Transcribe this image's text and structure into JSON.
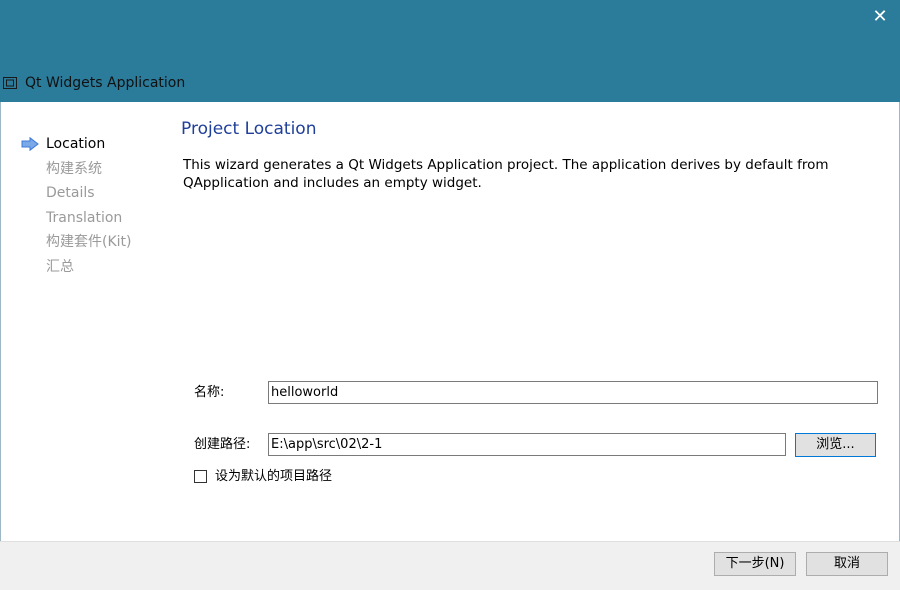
{
  "window": {
    "title": "Qt Widgets Application",
    "close_glyph": "✕",
    "icon": "qt-window-icon"
  },
  "nav": {
    "items": [
      {
        "label": "Location",
        "current": true
      },
      {
        "label": "构建系统",
        "current": false
      },
      {
        "label": "Details",
        "current": false
      },
      {
        "label": "Translation",
        "current": false
      },
      {
        "label": "构建套件(Kit)",
        "current": false
      },
      {
        "label": "汇总",
        "current": false
      }
    ],
    "current_indicator": "arrow-right-icon"
  },
  "page": {
    "title": "Project Location",
    "description": "This wizard generates a Qt Widgets Application project. The application derives by default from QApplication and includes an empty widget."
  },
  "form": {
    "name_label": "名称:",
    "name_value": "helloworld",
    "path_label": "创建路径:",
    "path_value": "E:\\app\\src\\02\\2-1",
    "browse_label": "浏览...",
    "default_path_label": "设为默认的项目路径",
    "default_path_checked": false
  },
  "footer": {
    "next_label": "下一步(N)",
    "cancel_label": "取消"
  },
  "colors": {
    "titlebar": "#2b7b9b",
    "page_title": "#1f3f9a",
    "nav_inactive": "#9a9a9a",
    "nav_arrow": "#3c78d8"
  }
}
